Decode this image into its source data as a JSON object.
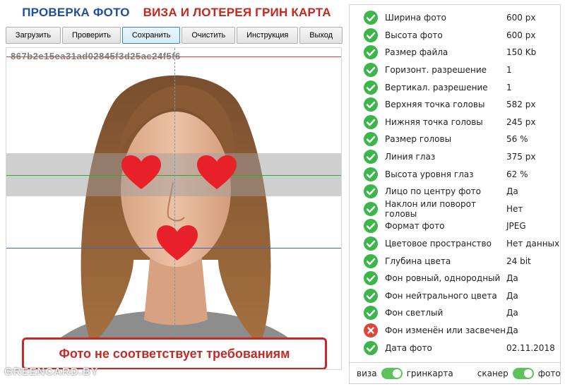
{
  "header": {
    "title_left": "ПРОВЕРКА ФОТО",
    "title_right": "ВИЗА И ЛОТЕРЕЯ ГРИН КАРТА"
  },
  "toolbar": {
    "load": "Загрузить",
    "check": "Проверить",
    "save": "Сохранить",
    "clear": "Очистить",
    "guide": "Инструкция",
    "exit": "Выход"
  },
  "photo": {
    "hash": "867b2e15ea31ad02845f3d25ac24f5f6",
    "verdict": "Фото не соответствует требованиям",
    "watermark": "GREENCARD.BY"
  },
  "checks": [
    {
      "label": "Ширина фото",
      "value": "600 px",
      "status": "ok"
    },
    {
      "label": "Высота фото",
      "value": "600 px",
      "status": "ok"
    },
    {
      "label": "Размер файла",
      "value": "150 Kb",
      "status": "ok"
    },
    {
      "label": "Горизонт. разрешение",
      "value": "1",
      "status": "ok"
    },
    {
      "label": "Вертикал. разрешение",
      "value": "1",
      "status": "ok"
    },
    {
      "label": "Верхняя точка головы",
      "value": "582 px",
      "status": "ok"
    },
    {
      "label": "Нижняя точка головы",
      "value": "245 px",
      "status": "ok"
    },
    {
      "label": "Размер головы",
      "value": "56 %",
      "status": "ok"
    },
    {
      "label": "Линия глаз",
      "value": "375 px",
      "status": "ok"
    },
    {
      "label": "Высота уровня глаз",
      "value": "62 %",
      "status": "ok"
    },
    {
      "label": "Лицо по центру фото",
      "value": "Да",
      "status": "ok"
    },
    {
      "label": "Наклон или поворот головы",
      "value": "Нет",
      "status": "ok"
    },
    {
      "label": "Формат фото",
      "value": "JPEG",
      "status": "ok"
    },
    {
      "label": "Цветовое пространство",
      "value": "Нет данных",
      "status": "ok"
    },
    {
      "label": "Глубина цвета",
      "value": "24 bit",
      "status": "ok"
    },
    {
      "label": "Фон ровный, однородный",
      "value": "Да",
      "status": "ok"
    },
    {
      "label": "Фон нейтрального цвета",
      "value": "Да",
      "status": "ok"
    },
    {
      "label": "Фон светлый",
      "value": "Да",
      "status": "ok"
    },
    {
      "label": "Фон изменён или засвечен",
      "value": "Да",
      "status": "fail"
    },
    {
      "label": "Дата фото",
      "value": "02.11.2018",
      "status": "ok"
    }
  ],
  "toggles": {
    "left_off": "виза",
    "left_on": "гринкарта",
    "right_off": "сканер",
    "right_on": "фото"
  },
  "colors": {
    "ok": "#3cb54a",
    "fail": "#e0443a",
    "title_blue": "#1f4fa0",
    "title_red": "#c8261c"
  }
}
